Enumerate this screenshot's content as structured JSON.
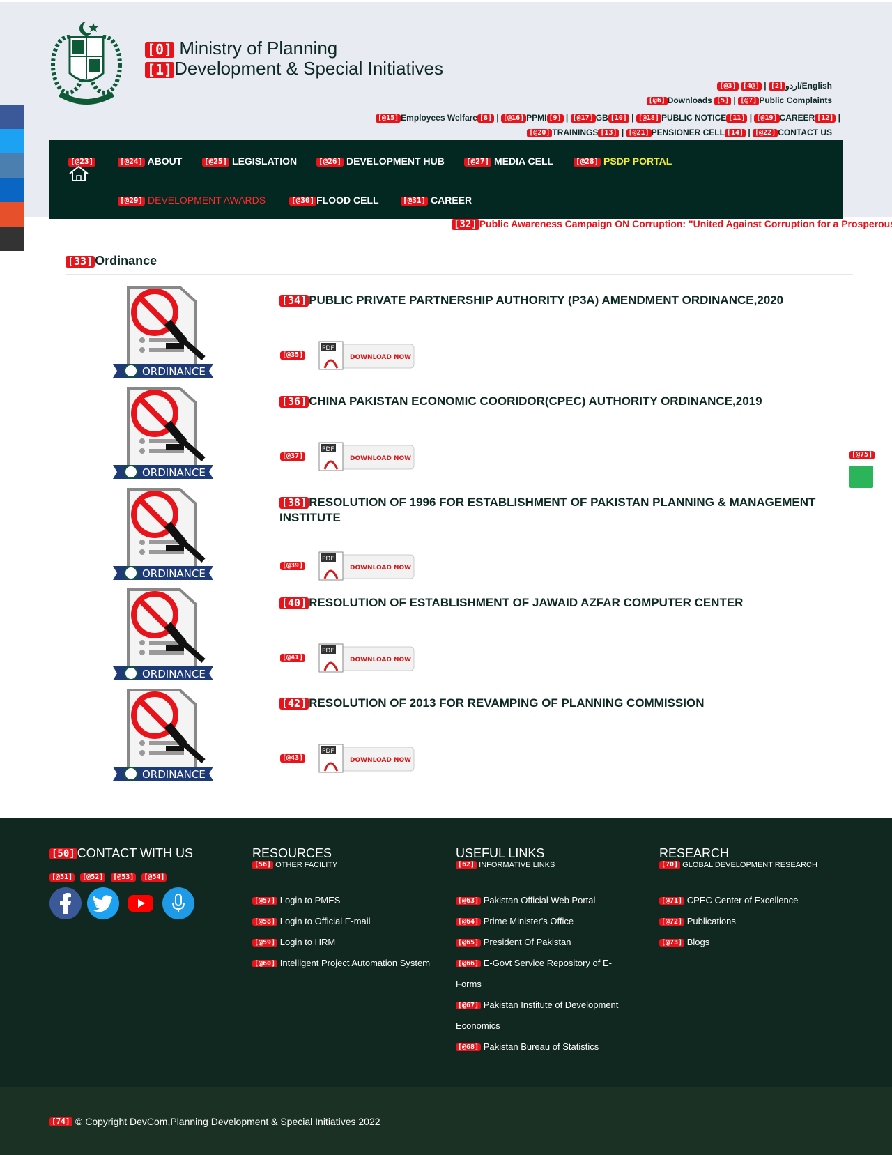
{
  "header": {
    "title_line1": "Ministry of Planning",
    "title_line2": "Development & Special Initiatives",
    "title_tag1": "[0]",
    "title_tag2": "[1]"
  },
  "toplinks": {
    "row1": [
      {
        "tag": "[@3]",
        "label": ""
      },
      {
        "tag": "[4@]",
        "label": ""
      },
      {
        "tag": "[2]",
        "label": "اردو/English"
      }
    ],
    "row2": [
      {
        "tag": "[@6]",
        "label": "Downloads"
      },
      {
        "tag": "[5]",
        "label": ""
      },
      {
        "tag": "[@7]",
        "label": "Public Complaints"
      }
    ],
    "row3": [
      {
        "tag": "[@15]",
        "label": "Employees Welfare",
        "tag2": "[8]"
      },
      {
        "tag": "[@16]",
        "label": "PPMI",
        "tag2": "[9]"
      },
      {
        "tag": "[@17]",
        "label": "GB",
        "tag2": "[10]"
      },
      {
        "tag": "[@18]",
        "label": "PUBLIC NOTICE",
        "tag2": "[11]"
      },
      {
        "tag": "[@19]",
        "label": "CAREER",
        "tag2": "[12]"
      }
    ],
    "row4": [
      {
        "tag": "[@20]",
        "label": "TRAININGS",
        "tag2": "[13]"
      },
      {
        "tag": "[@21]",
        "label": "PENSIONER CELL",
        "tag2": "[14]"
      },
      {
        "tag": "[@22]",
        "label": "CONTACT US"
      }
    ]
  },
  "nav": {
    "home_tag": "[@23]",
    "items": [
      {
        "tag": "[@24]",
        "label": "ABOUT"
      },
      {
        "tag": "[@25]",
        "label": "LEGISLATION"
      },
      {
        "tag": "[@26]",
        "label": "DEVELOPMENT HUB"
      },
      {
        "tag": "[@27]",
        "label": "MEDIA CELL"
      },
      {
        "tag": "[@28]",
        "label": "PSDP PORTAL"
      },
      {
        "tag": "[@29]",
        "label": "DEVELOPMENT AWARDS"
      },
      {
        "tag": "[@30]",
        "label": "FLOOD CELL"
      },
      {
        "tag": "[@31]",
        "label": "CAREER"
      }
    ]
  },
  "ticker": {
    "tag": "[32]",
    "text": "Public Awareness Campaign ON Corruption: \"United Against Corruption for a Prosperous"
  },
  "section": {
    "tag": "[33]",
    "title": "Ordinance"
  },
  "documents": [
    {
      "tag": "[34]",
      "title": "PUBLIC PRIVATE PARTNERSHIP AUTHORITY (P3A) AMENDMENT ORDINANCE,2020",
      "dl_tag": "[@35]"
    },
    {
      "tag": "[36]",
      "title": "CHINA PAKISTAN ECONOMIC COORIDOR(CPEC) AUTHORITY ORDINANCE,2019",
      "dl_tag": "[@37]"
    },
    {
      "tag": "[38]",
      "title": "RESOLUTION OF 1996 FOR ESTABLISHMENT OF PAKISTAN PLANNING & MANAGEMENT INSTITUTE",
      "dl_tag": "[@39]"
    },
    {
      "tag": "[40]",
      "title": "RESOLUTION OF ESTABLISHMENT OF JAWAID AZFAR COMPUTER CENTER",
      "dl_tag": "[@41]"
    },
    {
      "tag": "[42]",
      "title": "RESOLUTION OF 2013 FOR REVAMPING OF PLANNING COMMISSION",
      "dl_tag": "[@43]"
    }
  ],
  "doc_icon_label": "ORDINANCE",
  "download_label": "DOWNLOAD NOW",
  "pdf_label": "PDF",
  "float_tag": "[@75]",
  "footer": {
    "contact": {
      "tag": "[50]",
      "title": "CONTACT WITH US",
      "social_tags": [
        "[@51]",
        "[@52]",
        "[@53]",
        "[@54]"
      ]
    },
    "resources": {
      "title": "RESOURCES",
      "sub_tag": "[56]",
      "sub": "OTHER FACILITY",
      "links": [
        {
          "tag": "[@57]",
          "label": "Login to PMES"
        },
        {
          "tag": "[@58]",
          "label": "Login to Official E-mail"
        },
        {
          "tag": "[@59]",
          "label": "Login to HRM"
        },
        {
          "tag": "[@60]",
          "label": "Intelligent Project Automation System"
        }
      ]
    },
    "useful": {
      "title": "USEFUL LINKS",
      "sub_tag": "[62]",
      "sub": "INFORMATIVE LINKS",
      "links": [
        {
          "tag": "[@63]",
          "label": "Pakistan Official Web Portal"
        },
        {
          "tag": "[@64]",
          "label": "Prime Minister's Office"
        },
        {
          "tag": "[@65]",
          "label": "President Of Pakistan"
        },
        {
          "tag": "[@66]",
          "label": "E-Govt Service Repository of E-Forms"
        },
        {
          "tag": "[@67]",
          "label": "Pakistan Institute of Development Economics"
        },
        {
          "tag": "[@68]",
          "label": "Pakistan Bureau of Statistics"
        }
      ]
    },
    "research": {
      "title": "RESEARCH",
      "sub_tag": "[70]",
      "sub": "GLOBAL DEVELOPMENT RESEARCH",
      "links": [
        {
          "tag": "[@71]",
          "label": "CPEC Center of Excellence"
        },
        {
          "tag": "[@72]",
          "label": "Publications"
        },
        {
          "tag": "[@73]",
          "label": "Blogs"
        }
      ]
    }
  },
  "copyright": {
    "tag": "[74]",
    "text": "© Copyright DevCom,Planning Development & Special Initiatives 2022"
  },
  "colors": {
    "nav_bg": "#032721",
    "footer_bg": "#102820",
    "accent_red": "#e8141b",
    "psdp_yellow": "#f5ec2b",
    "header_bg": "#e9ebf3"
  }
}
